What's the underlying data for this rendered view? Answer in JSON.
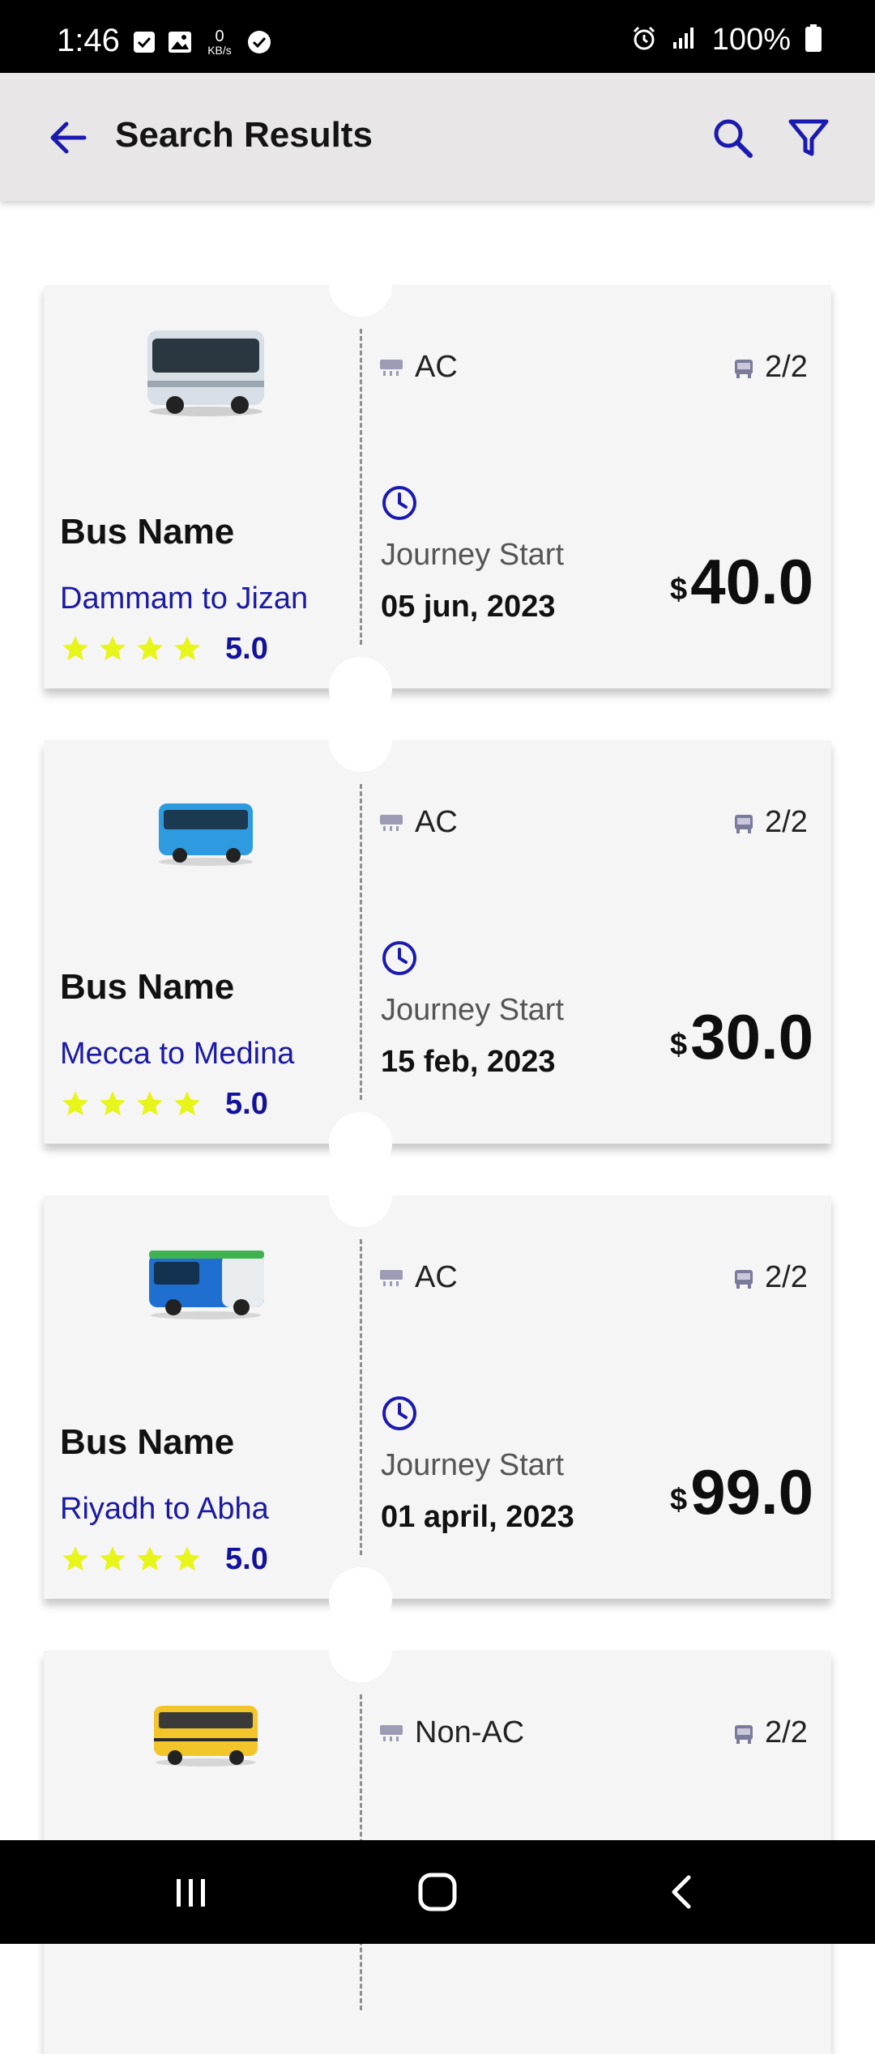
{
  "status_bar": {
    "time": "1:46",
    "net_speed_value": "0",
    "net_speed_unit": "KB/s",
    "battery": "100%"
  },
  "app_bar": {
    "title": "Search Results",
    "accent": "#1a1ab0"
  },
  "tickets": [
    {
      "bus_name": "Bus Name",
      "route": "Dammam to Jizan",
      "rating": "5.0",
      "ac": "AC",
      "seats": "2/2",
      "journey_label": "Journey Start",
      "date": "05 jun, 2023",
      "currency": "$",
      "price": "40.0",
      "bus_color": "#d9dfe6"
    },
    {
      "bus_name": "Bus Name",
      "route": "Mecca to Medina",
      "rating": "5.0",
      "ac": "AC",
      "seats": "2/2",
      "journey_label": "Journey Start",
      "date": "15 feb, 2023",
      "currency": "$",
      "price": "30.0",
      "bus_color": "#2e9be0"
    },
    {
      "bus_name": "Bus Name",
      "route": "Riyadh to Abha",
      "rating": "5.0",
      "ac": "AC",
      "seats": "2/2",
      "journey_label": "Journey Start",
      "date": "01 april, 2023",
      "currency": "$",
      "price": "99.0",
      "bus_color": "#1f6fd0"
    },
    {
      "ac": "Non-AC",
      "seats": "2/2",
      "bus_color": "#f2c62a"
    }
  ]
}
